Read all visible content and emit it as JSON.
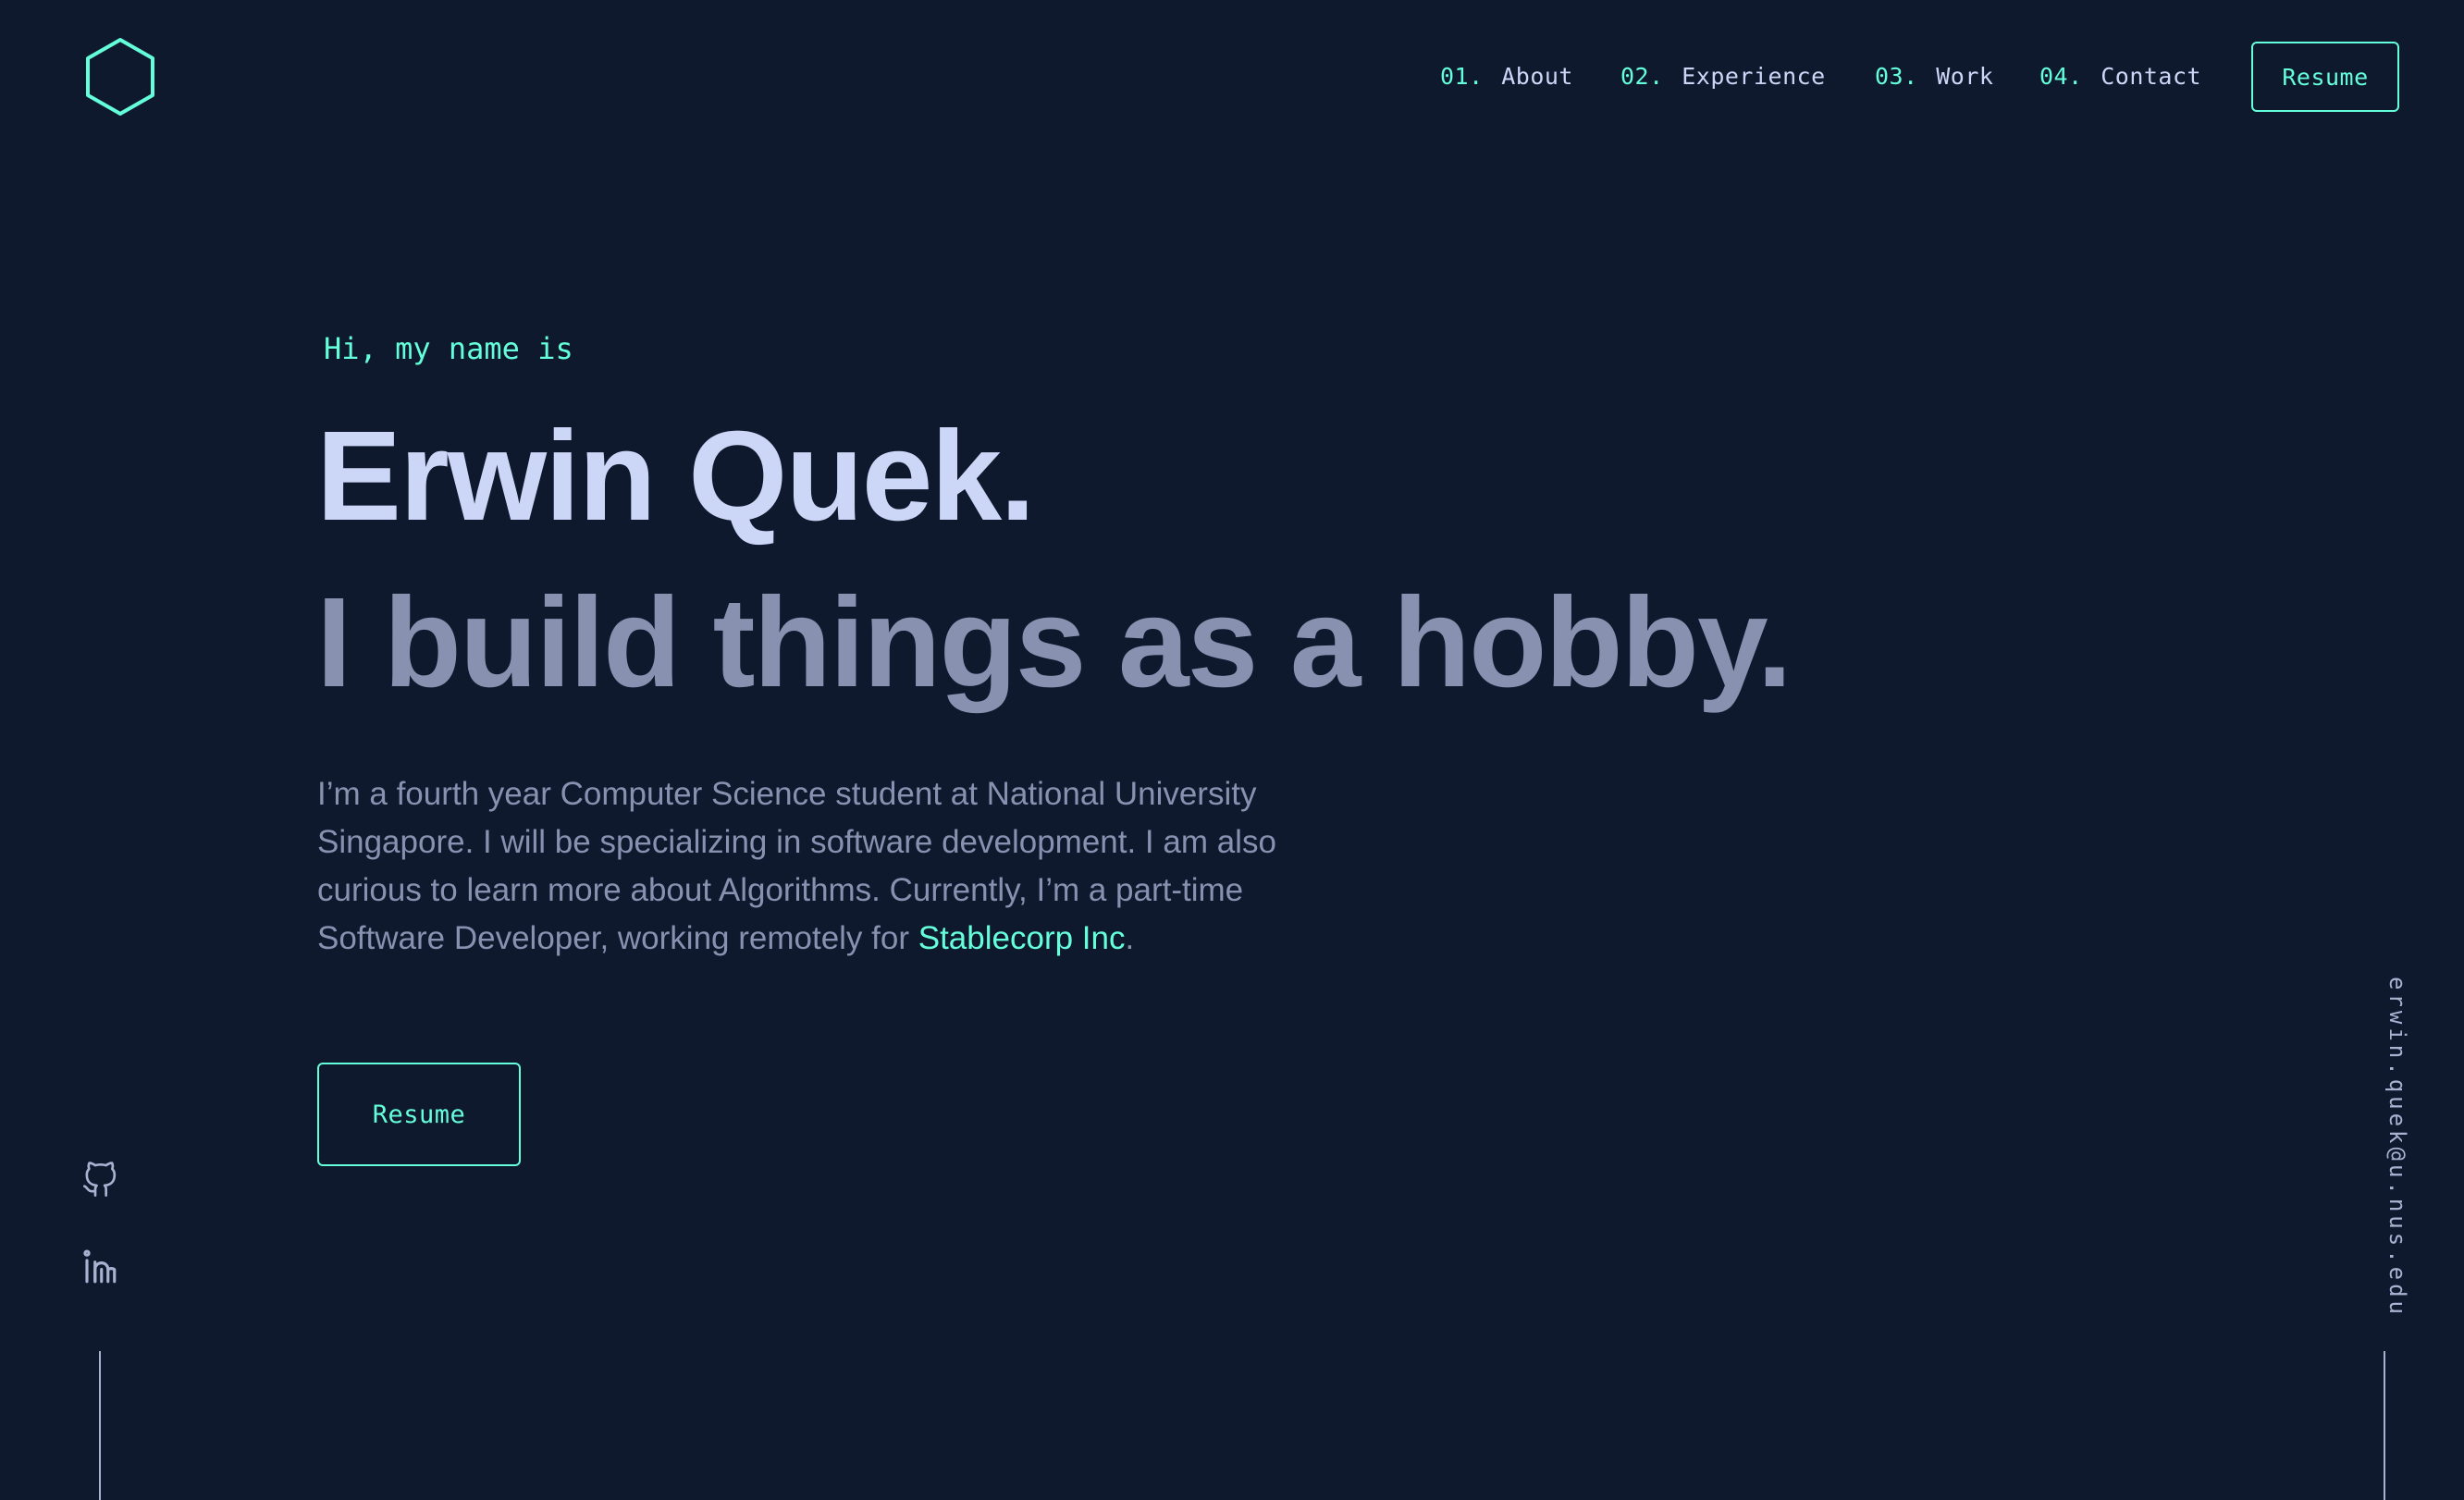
{
  "colors": {
    "background": "#0e192e",
    "accent": "#64ffda",
    "heading": "#ccd6f6",
    "muted": "#8892b0",
    "rail": "#a8b2d1"
  },
  "header": {
    "logo_icon": "hexagon-logo-icon",
    "nav": [
      {
        "number": "01.",
        "label": "About"
      },
      {
        "number": "02.",
        "label": "Experience"
      },
      {
        "number": "03.",
        "label": "Work"
      },
      {
        "number": "04.",
        "label": "Contact"
      }
    ],
    "resume_label": "Resume"
  },
  "hero": {
    "greeting": "Hi, my name is",
    "name": "Erwin Quek.",
    "tagline": "I build things as a hobby.",
    "bio_text": "I’m a fourth year Computer Science student at National University Singapore. I will be specializing in software development. I am also curious to learn more about Algorithms. Currently, I’m a part-time Software Developer, working remotely for ",
    "bio_link": "Stablecorp Inc",
    "bio_end": ".",
    "resume_label": "Resume"
  },
  "social": [
    {
      "icon": "github-icon"
    },
    {
      "icon": "linkedin-icon"
    }
  ],
  "email": "erwin.quek@u.nus.edu"
}
